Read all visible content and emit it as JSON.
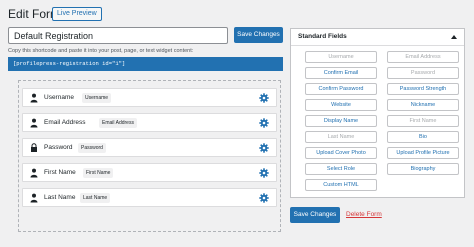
{
  "header": {
    "title": "Edit Form",
    "preview_label": "Live Preview"
  },
  "form": {
    "title_value": "Default Registration",
    "save_label": "Save Changes"
  },
  "shortcode": {
    "hint": "Copy this shortcode and paste it into your post, page, or text widget content:",
    "code": "[profilepress-registration id=\"1\"]"
  },
  "builder": {
    "fields": [
      {
        "label": "Username",
        "badge": "Username",
        "icon": "user-icon"
      },
      {
        "label": "Email Address",
        "badge": "Email Address",
        "icon": "user-icon"
      },
      {
        "label": "Password",
        "badge": "Password",
        "icon": "lock-icon"
      },
      {
        "label": "First Name",
        "badge": "First Name",
        "icon": "user-icon"
      },
      {
        "label": "Last Name",
        "badge": "Last Name",
        "icon": "user-icon"
      }
    ]
  },
  "panel": {
    "title": "Standard Fields",
    "chips": [
      {
        "label": "Username",
        "state": "used"
      },
      {
        "label": "Email Address",
        "state": "used"
      },
      {
        "label": "Confirm Email",
        "state": "available"
      },
      {
        "label": "Password",
        "state": "used"
      },
      {
        "label": "Confirm Password",
        "state": "available"
      },
      {
        "label": "Password Strength",
        "state": "available"
      },
      {
        "label": "Website",
        "state": "available"
      },
      {
        "label": "Nickname",
        "state": "available"
      },
      {
        "label": "Display Name",
        "state": "available"
      },
      {
        "label": "First Name",
        "state": "used"
      },
      {
        "label": "Last Name",
        "state": "used"
      },
      {
        "label": "Bio",
        "state": "available"
      },
      {
        "label": "Upload Cover Photo",
        "state": "available"
      },
      {
        "label": "Upload Profile Picture",
        "state": "available"
      },
      {
        "label": "Select Role",
        "state": "available"
      },
      {
        "label": "Biography",
        "state": "available"
      },
      {
        "label": "Custom HTML",
        "state": "available"
      }
    ]
  },
  "footer": {
    "save_label": "Save Changes",
    "delete_label": "Delete Form"
  },
  "colors": {
    "accent": "#2271b1",
    "danger": "#d63638",
    "muted": "#a7aaad"
  }
}
